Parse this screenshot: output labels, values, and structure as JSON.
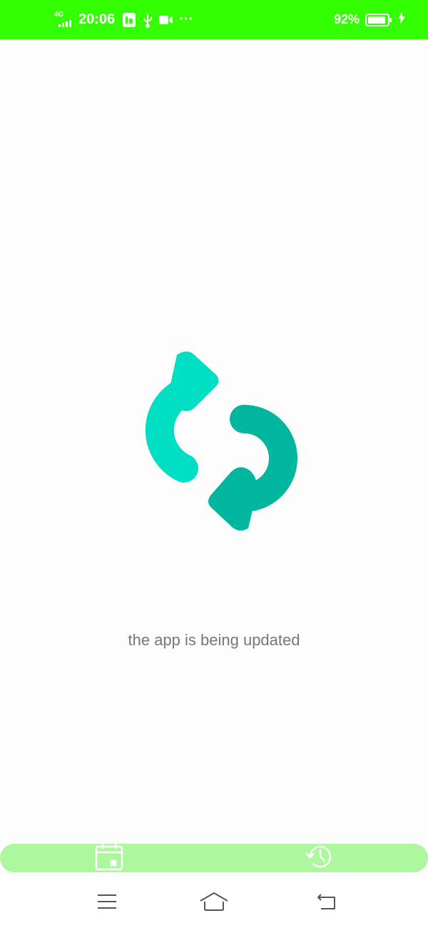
{
  "status_bar": {
    "network": "4G",
    "time": "20:06",
    "more": "···",
    "battery_percent_text": "92%",
    "battery_level": 0.92,
    "background_color": "#33ff00"
  },
  "icons": {
    "update": "sync-arrows-icon",
    "calendar": "calendar-icon",
    "history": "history-icon",
    "menu": "menu-icon",
    "home": "home-icon",
    "back": "back-icon"
  },
  "colors": {
    "arrow_light": "#00dec4",
    "arrow_dark": "#00b69f",
    "tabbar": "#adf79e",
    "message_text": "#777777"
  },
  "main": {
    "message": "the app is being updated"
  }
}
